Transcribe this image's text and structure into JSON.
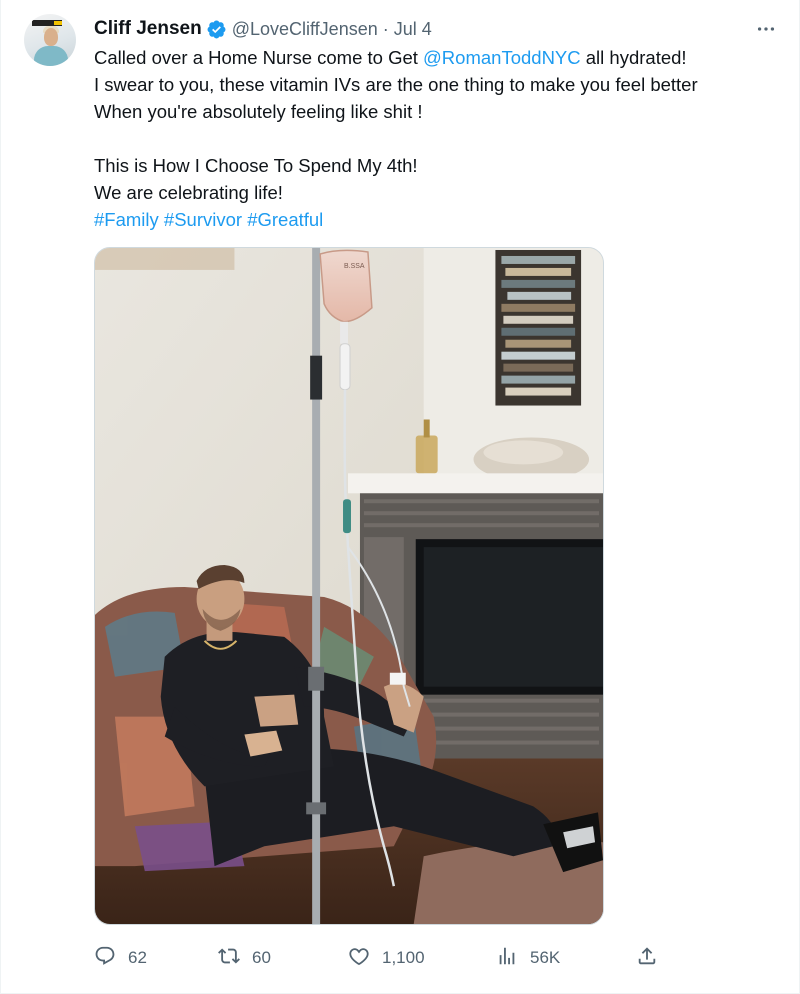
{
  "tweet": {
    "author_name": "Cliff Jensen",
    "handle": "@LoveCliffJensen",
    "separator": "·",
    "date": "Jul 4",
    "text": {
      "line1_prefix": "Called over a Home Nurse come to Get ",
      "line1_mention": "@RomanToddNYC",
      "line1_suffix": " all hydrated!",
      "line2": "I swear to you, these vitamin IVs are the one thing to make you feel better",
      "line3": "When you're absolutely feeling like shit !",
      "line4": "This is How I Choose To Spend My 4th!",
      "line5": "We are celebrating life!",
      "hashtags": [
        "#Family",
        "#Survivor",
        "#Greatful"
      ]
    },
    "media": {
      "iv_bag_label": "B.SSA"
    },
    "stats": {
      "replies": "62",
      "reposts": "60",
      "likes": "1,100",
      "views": "56K"
    }
  },
  "icons": {
    "verified": "verified-badge-icon",
    "more": "more-options-icon",
    "reply": "reply-icon",
    "repost": "repost-icon",
    "like": "like-icon",
    "views": "views-icon",
    "share": "share-icon"
  },
  "colors": {
    "accent": "#1d9bf0",
    "text": "#0f1419",
    "secondary": "#536471"
  }
}
